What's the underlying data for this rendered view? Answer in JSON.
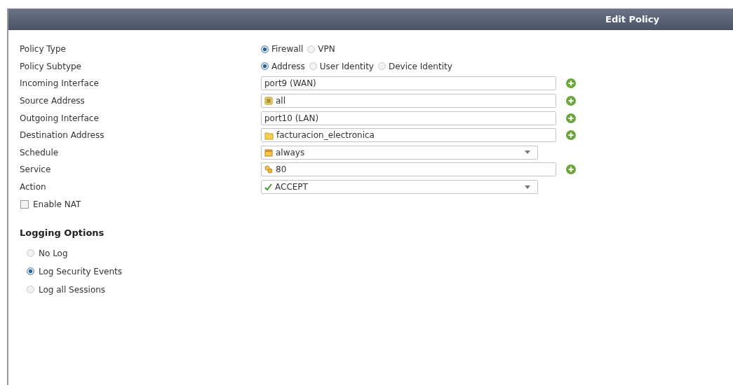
{
  "header": {
    "title": "Edit Policy"
  },
  "rows": [
    {
      "kind": "radio",
      "label": "Policy Type",
      "options": [
        {
          "label": "Firewall",
          "selected": true
        },
        {
          "label": "VPN",
          "selected": false
        }
      ]
    },
    {
      "kind": "radio",
      "label": "Policy Subtype",
      "options": [
        {
          "label": "Address",
          "selected": true
        },
        {
          "label": "User Identity",
          "selected": false
        },
        {
          "label": "Device Identity",
          "selected": false
        }
      ]
    },
    {
      "kind": "field",
      "label": "Incoming Interface",
      "value": {
        "kind": "interface",
        "text": "port9 (WAN)"
      }
    },
    {
      "kind": "field",
      "label": "Source Address",
      "value": {
        "kind": "address",
        "text": "all"
      }
    },
    {
      "kind": "field",
      "label": "Outgoing Interface",
      "value": {
        "kind": "interface",
        "text": "port10 (LAN)"
      }
    },
    {
      "kind": "field",
      "label": "Destination Address",
      "value": {
        "kind": "group",
        "text": "facturacion_electronica"
      }
    },
    {
      "kind": "select",
      "label": "Schedule",
      "value": {
        "kind": "schedule",
        "text": "always"
      }
    },
    {
      "kind": "field",
      "label": "Service",
      "value": {
        "kind": "service",
        "text": "80"
      }
    },
    {
      "kind": "select",
      "label": "Action",
      "value": {
        "kind": "accept",
        "text": "ACCEPT"
      }
    }
  ],
  "nat": {
    "label": "Enable NAT",
    "checked": false
  },
  "logging": {
    "title": "Logging Options",
    "options": [
      {
        "label": "No Log",
        "selected": false
      },
      {
        "label": "Log Security Events",
        "selected": true
      },
      {
        "label": "Log all Sessions",
        "selected": false
      }
    ]
  }
}
